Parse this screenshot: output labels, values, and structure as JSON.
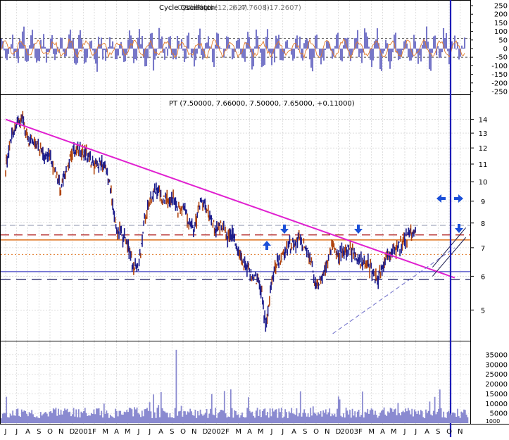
{
  "colors": {
    "background": "#ffffff",
    "price_candles": "#1c1c8c",
    "price_down": "#b0440e",
    "trendline": "#e020d0",
    "cycle_fill": "#7777c8",
    "cycle_line": "#e07a2a",
    "volume_fill": "#8a8ad0",
    "blue_line": "#1d1db8",
    "orange_line": "#e07a2a",
    "red_dash": "#b02020",
    "navy_dash": "#2a2a6a",
    "arrow_blue": "#1a4fd8",
    "grid": "#c8c8c8"
  },
  "cycle_panel": {
    "title": "Cycle Oscillator",
    "title_overlap_fragments": [
      "CyclePhase",
      "Strength(12,26,4)",
      "(-27.7608)",
      "(-17.2607)"
    ],
    "yticks": [
      "250",
      "200",
      "150",
      "100",
      "50",
      "0",
      "-50",
      "-100",
      "-150",
      "-200",
      "-250"
    ],
    "ylim": [
      -250,
      250
    ]
  },
  "price_panel": {
    "title": "PT (7.50000, 7.66000, 7.50000, 7.65000, +0.11000)",
    "yticks": [
      "14",
      "13",
      "12",
      "11",
      "10",
      "9",
      "8",
      "7",
      "6",
      "5"
    ],
    "ylim": [
      4.3,
      14.8
    ],
    "scale": "log"
  },
  "volume_panel": {
    "yticks": [
      "35000",
      "30000",
      "25000",
      "20000",
      "15000",
      "10000",
      "5000"
    ],
    "last_tick": "1000",
    "ylim": [
      0,
      40000
    ]
  },
  "x_axis": {
    "labels": [
      "J",
      "J",
      "A",
      "S",
      "O",
      "N",
      "D",
      "2001",
      "F",
      "M",
      "A",
      "M",
      "J",
      "J",
      "A",
      "S",
      "O",
      "N",
      "D",
      "2002",
      "F",
      "M",
      "A",
      "M",
      "J",
      "J",
      "A",
      "S",
      "O",
      "N",
      "D",
      "2003",
      "F",
      "M",
      "A",
      "M",
      "J",
      "J",
      "A",
      "S",
      "O",
      "N"
    ]
  },
  "chart_data": {
    "type": "line",
    "price_series": {
      "x_months": [
        0,
        0.5,
        1,
        1.5,
        2,
        2.5,
        3,
        3.5,
        4,
        4.5,
        5,
        5.5,
        6,
        6.5,
        7,
        7.5,
        8,
        8.5,
        9,
        9.5,
        10,
        10.5,
        11,
        11.5,
        12,
        12.5,
        13,
        13.5,
        14,
        14.5,
        15,
        15.5,
        16,
        16.5,
        17,
        17.5,
        18,
        18.5,
        19,
        19.5,
        20,
        20.5,
        21,
        21.5,
        22,
        22.5,
        23,
        23.5,
        24,
        24.5,
        25,
        25.5,
        26,
        26.5,
        27,
        27.5,
        28,
        28.5,
        29,
        29.5,
        30,
        30.5,
        31,
        31.5,
        32,
        32.5,
        33,
        33.5,
        34,
        34.5,
        35,
        35.5,
        36,
        36.5,
        37,
        37.5,
        38,
        38.5,
        39,
        39.5,
        40,
        40.5,
        41
      ],
      "values": [
        10.9,
        12.6,
        13.6,
        13.9,
        12.6,
        12.3,
        12.1,
        11.5,
        11.4,
        10.6,
        9.6,
        10.7,
        11.6,
        12.1,
        11.7,
        11.4,
        10.8,
        11.1,
        10.7,
        9.5,
        7.7,
        7.5,
        7.1,
        6.4,
        6.3,
        8.0,
        9.0,
        9.7,
        9.3,
        9.1,
        9.2,
        8.6,
        8.6,
        8.2,
        7.7,
        8.9,
        8.8,
        8.1,
        7.8,
        7.9,
        7.3,
        7.5,
        6.9,
        6.4,
        6.1,
        6.0,
        5.6,
        4.5,
        5.9,
        6.5,
        6.7,
        7.1,
        7.1,
        7.4,
        7.0,
        6.6,
        5.7,
        6.0,
        6.5,
        7.1,
        6.8,
        6.8,
        7.0,
        6.7,
        6.5,
        6.5,
        6.2,
        5.9,
        6.3,
        6.7,
        6.9,
        7.1,
        7.3,
        7.6,
        7.65
      ]
    },
    "horizontal_levels": [
      {
        "value": 7.9,
        "style": "light dashed"
      },
      {
        "value": 7.5,
        "style": "red dashed"
      },
      {
        "value": 7.3,
        "style": "orange solid"
      },
      {
        "value": 6.75,
        "style": "orange dotted"
      },
      {
        "value": 6.15,
        "style": "blue solid"
      },
      {
        "value": 5.9,
        "style": "navy dashed"
      }
    ],
    "trendline": {
      "from": [
        0,
        14.0
      ],
      "to": [
        40.5,
        5.95
      ]
    },
    "support_line": {
      "from": [
        29.5,
        4.4
      ],
      "to": [
        40.5,
        7.0
      ]
    },
    "channel": {
      "lower": [
        [
          38.5,
          6.0
        ],
        [
          41.5,
          7.4
        ]
      ],
      "upper": [
        [
          38.5,
          6.3
        ],
        [
          41.5,
          7.8
        ]
      ]
    }
  }
}
